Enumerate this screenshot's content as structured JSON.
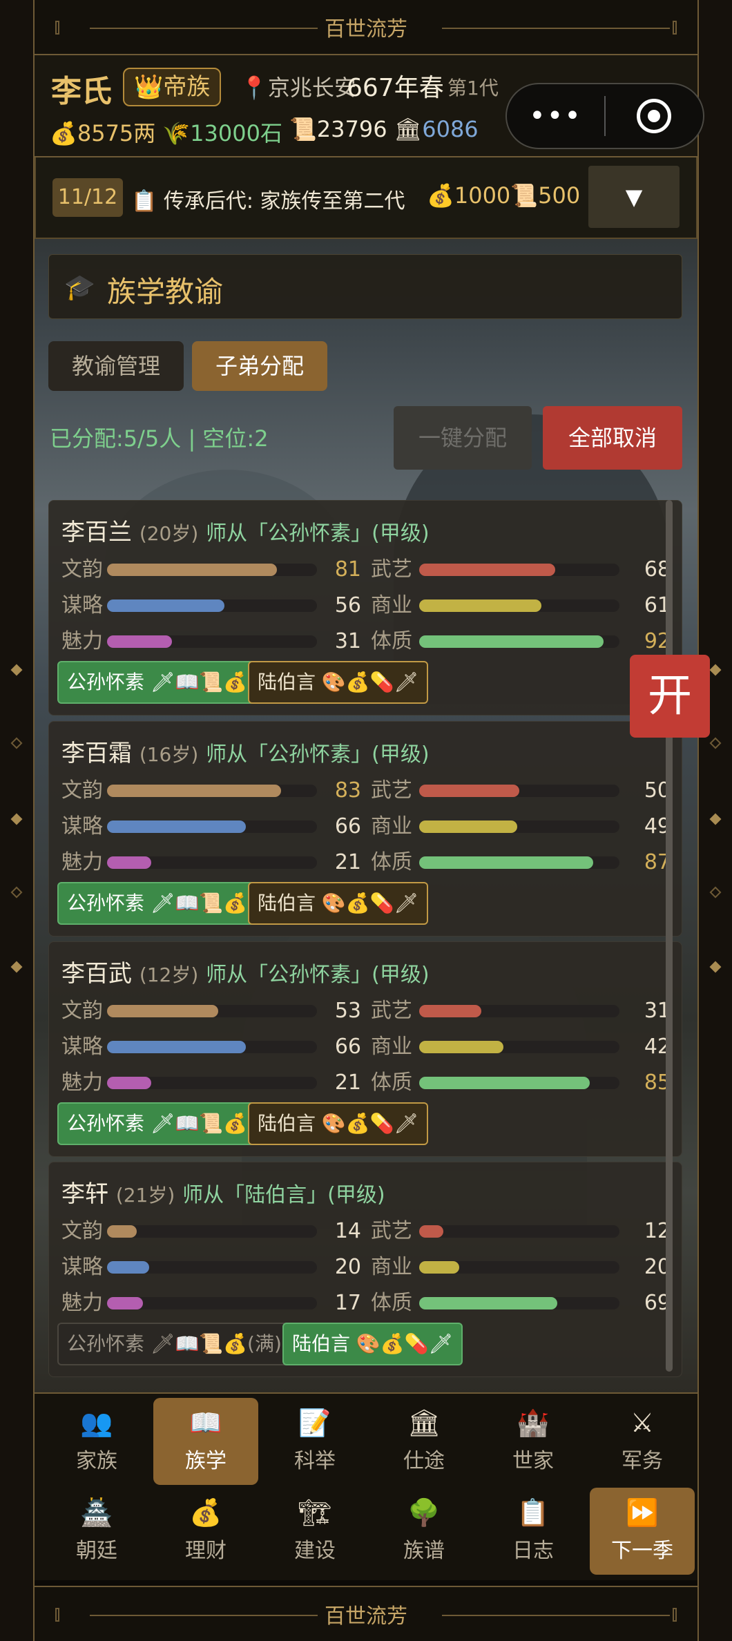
{
  "frame": {
    "top_title": "百世流芳",
    "bottom_title": "百世流芳"
  },
  "header": {
    "clan": "李氏",
    "rank_icon": "crown-icon",
    "rank": "帝族",
    "location_icon": "pin-icon",
    "location": "京兆长安",
    "year": "667年春",
    "generation": "第1代",
    "resources": [
      {
        "icon": "money-bag-icon",
        "glyph": "💰",
        "value": "8575两",
        "color": "#e8c16b"
      },
      {
        "icon": "grain-icon",
        "glyph": "🌾",
        "value": "13000石",
        "color": "#7ed08d"
      },
      {
        "icon": "scroll-icon",
        "glyph": "📜",
        "value": "23796",
        "color": "#f2ead6"
      },
      {
        "icon": "building-icon",
        "glyph": "🏛",
        "value": "6086",
        "color": "#7fa8d8"
      }
    ]
  },
  "miniprogram": {
    "more": "•••"
  },
  "quest": {
    "progress": "11/12",
    "icon": "clipboard-icon",
    "text": "传承后代: 家族传至第二代",
    "cost_money": "💰1000",
    "cost_scroll": "📜500",
    "toggle": "▼"
  },
  "section": {
    "icon": "graduation-cap-icon",
    "title": "族学教谕"
  },
  "tabs": [
    {
      "label": "教谕管理",
      "active": false
    },
    {
      "label": "子弟分配",
      "active": true
    }
  ],
  "assign": {
    "summary": "已分配:5/5人 | 空位:2",
    "auto_button": "一键分配",
    "cancel_button": "全部取消"
  },
  "float_button": "开",
  "students": [
    {
      "name": "李百兰",
      "age": "(20岁)",
      "teacher": "师从「公孙怀素」(甲级)",
      "stats": [
        {
          "label": "文韵",
          "value": 81,
          "hi": true,
          "color": "#b08a5e"
        },
        {
          "label": "武艺",
          "value": 68,
          "hi": false,
          "color": "#c05a4a"
        },
        {
          "label": "谋略",
          "value": 56,
          "hi": false,
          "color": "#5f86c0"
        },
        {
          "label": "商业",
          "value": 61,
          "hi": false,
          "color": "#c2b244"
        },
        {
          "label": "魅力",
          "value": 31,
          "hi": false,
          "color": "#b45eb0"
        },
        {
          "label": "体质",
          "value": 92,
          "hi": true,
          "color": "#74c27a"
        }
      ],
      "teachers": [
        {
          "name": "公孙怀素 🗡📖📜💰",
          "style": "green"
        },
        {
          "name": "陆伯言 🎨💰💊🗡",
          "style": "gold"
        }
      ]
    },
    {
      "name": "李百霜",
      "age": "(16岁)",
      "teacher": "师从「公孙怀素」(甲级)",
      "stats": [
        {
          "label": "文韵",
          "value": 83,
          "hi": true,
          "color": "#b08a5e"
        },
        {
          "label": "武艺",
          "value": 50,
          "hi": false,
          "color": "#c05a4a"
        },
        {
          "label": "谋略",
          "value": 66,
          "hi": false,
          "color": "#5f86c0"
        },
        {
          "label": "商业",
          "value": 49,
          "hi": false,
          "color": "#c2b244"
        },
        {
          "label": "魅力",
          "value": 21,
          "hi": false,
          "color": "#b45eb0"
        },
        {
          "label": "体质",
          "value": 87,
          "hi": true,
          "color": "#74c27a"
        }
      ],
      "teachers": [
        {
          "name": "公孙怀素 🗡📖📜💰",
          "style": "green"
        },
        {
          "name": "陆伯言 🎨💰💊🗡",
          "style": "gold"
        }
      ]
    },
    {
      "name": "李百武",
      "age": "(12岁)",
      "teacher": "师从「公孙怀素」(甲级)",
      "stats": [
        {
          "label": "文韵",
          "value": 53,
          "hi": false,
          "color": "#b08a5e"
        },
        {
          "label": "武艺",
          "value": 31,
          "hi": false,
          "color": "#c05a4a"
        },
        {
          "label": "谋略",
          "value": 66,
          "hi": false,
          "color": "#5f86c0"
        },
        {
          "label": "商业",
          "value": 42,
          "hi": false,
          "color": "#c2b244"
        },
        {
          "label": "魅力",
          "value": 21,
          "hi": false,
          "color": "#b45eb0"
        },
        {
          "label": "体质",
          "value": 85,
          "hi": true,
          "color": "#74c27a"
        }
      ],
      "teachers": [
        {
          "name": "公孙怀素 🗡📖📜💰",
          "style": "green"
        },
        {
          "name": "陆伯言 🎨💰💊🗡",
          "style": "gold"
        }
      ]
    },
    {
      "name": "李轩",
      "age": "(21岁)",
      "teacher": "师从「陆伯言」(甲级)",
      "stats": [
        {
          "label": "文韵",
          "value": 14,
          "hi": false,
          "color": "#b08a5e"
        },
        {
          "label": "武艺",
          "value": 12,
          "hi": false,
          "color": "#c05a4a"
        },
        {
          "label": "谋略",
          "value": 20,
          "hi": false,
          "color": "#5f86c0"
        },
        {
          "label": "商业",
          "value": 20,
          "hi": false,
          "color": "#c2b244"
        },
        {
          "label": "魅力",
          "value": 17,
          "hi": false,
          "color": "#b45eb0"
        },
        {
          "label": "体质",
          "value": 69,
          "hi": false,
          "color": "#74c27a"
        }
      ],
      "teachers": [
        {
          "name": "公孙怀素 🗡📖📜💰(满)",
          "style": "dim"
        },
        {
          "name": "陆伯言 🎨💰💊🗡",
          "style": "green"
        }
      ]
    }
  ],
  "nav": [
    {
      "label": "家族",
      "icon": "family-icon",
      "glyph": "👥",
      "active": false
    },
    {
      "label": "族学",
      "icon": "book-icon",
      "glyph": "📖",
      "active": true
    },
    {
      "label": "科举",
      "icon": "memo-icon",
      "glyph": "📝",
      "active": false
    },
    {
      "label": "仕途",
      "icon": "government-icon",
      "glyph": "🏛",
      "active": false
    },
    {
      "label": "世家",
      "icon": "castle-icon",
      "glyph": "🏰",
      "active": false
    },
    {
      "label": "军务",
      "icon": "swords-icon",
      "glyph": "⚔",
      "active": false
    },
    {
      "label": "朝廷",
      "icon": "palace-icon",
      "glyph": "🏯",
      "active": false
    },
    {
      "label": "理财",
      "icon": "money-bag-icon",
      "glyph": "💰",
      "active": false
    },
    {
      "label": "建设",
      "icon": "crane-icon",
      "glyph": "🏗",
      "active": false
    },
    {
      "label": "族谱",
      "icon": "tree-icon",
      "glyph": "🌳",
      "active": false
    },
    {
      "label": "日志",
      "icon": "clipboard-icon",
      "glyph": "📋",
      "active": false
    },
    {
      "label": "下一季",
      "icon": "fast-forward-icon",
      "glyph": "⏩",
      "active": true
    }
  ]
}
